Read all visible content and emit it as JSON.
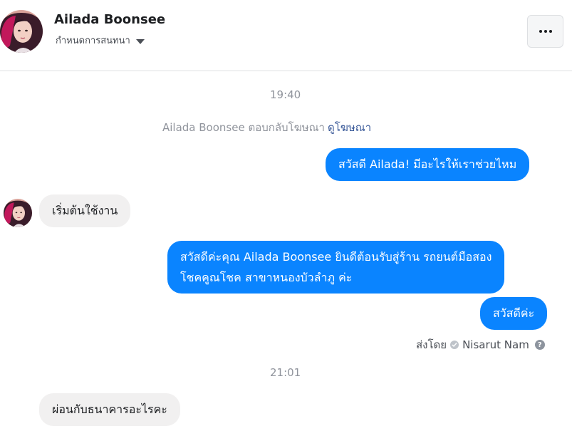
{
  "header": {
    "name": "Ailada Boonsee",
    "subtitle": "กำหนดการสนทนา",
    "more_icon": "more-horizontal-icon"
  },
  "thread": {
    "timestamp_1": "19:40",
    "ad_notice": {
      "text": "Ailada Boonsee ตอบกลับโฆษณา",
      "link": "ดูโฆษณา"
    },
    "msg_1": "สวัสดี Ailada! มีอะไรให้เราช่วยไหม",
    "msg_2": "เริ่มต้นใช้งาน",
    "msg_3_line1": "สวัสดีค่ะคุณ Ailada Boonsee ยินดีต้อนรับสู่ร้าน รถยนต์มือสอง",
    "msg_3_line2": "โชคคูณโชค สาขาหนองบัวลำภู ค่ะ",
    "msg_4": "สวัสดีค่ะ",
    "sent_by_label": "ส่งโดย",
    "sent_by_name": "Nisarut Nam",
    "timestamp_2": "21:01",
    "msg_5": "ผ่อนกับธนาคารอะไรคะ"
  },
  "colors": {
    "outgoing_bubble": "#0a84ff",
    "incoming_bubble": "#f1f0f0",
    "link": "#385898"
  }
}
